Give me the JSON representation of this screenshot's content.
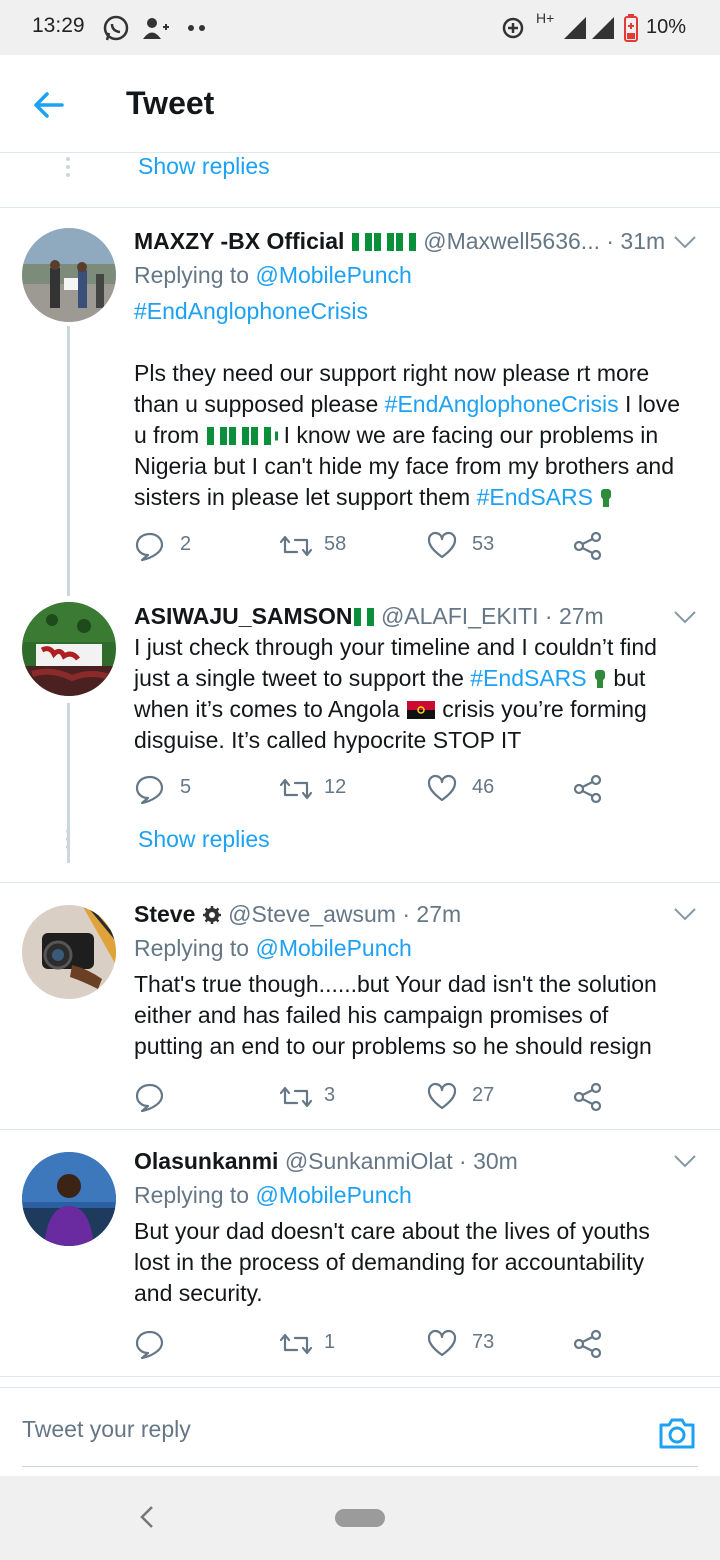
{
  "status_bar": {
    "time": "13:29",
    "battery": "10%",
    "network": "H+"
  },
  "app_bar": {
    "title": "Tweet"
  },
  "top_show_replies": "Show replies",
  "tweets": [
    {
      "name": "MAXZY -BX Official",
      "handle": "@Maxwell5636...",
      "time": "· 31m",
      "replying_prefix": "Replying to ",
      "replying_to": "@MobilePunch",
      "hashtag_line": "#EndAnglophoneCrisis",
      "body": {
        "l1": "Pls they need our support right now please rt more",
        "l2a": "than u supposed please ",
        "l2tag": "#EndAnglophoneCrisis",
        "l2b": " I love",
        "l3a": "u from ",
        "l3b": "I know we are facing our problems in",
        "l4": "Nigeria but I can't hide my face from my brothers and",
        "l5a": "sisters in please let support them ",
        "l5tag": "#EndSARS"
      },
      "replies": "2",
      "retweets": "58",
      "likes": "53"
    },
    {
      "name": "ASIWAJU_SAMSON",
      "handle": "@ALAFI_EKITI",
      "time": "· 27m",
      "body": {
        "l1": "I just check through your timeline and I couldn’t find",
        "l2a": "just a single tweet to support the ",
        "l2tag": "#EndSARS",
        "l2b": " but",
        "l3a": "when it’s comes to Angola ",
        "l3b": " crisis you’re forming",
        "l4": "disguise. It’s called hypocrite STOP IT"
      },
      "replies": "5",
      "retweets": "12",
      "likes": "46",
      "show_replies": "Show replies"
    },
    {
      "name": "Steve",
      "handle": "@Steve_awsum",
      "time": "· 27m",
      "replying_prefix": "Replying to ",
      "replying_to": "@MobilePunch",
      "body": {
        "l1": "That's true though......but Your dad isn't the solution",
        "l2": "either and has failed his campaign promises of",
        "l3": "putting an end to our problems so he should resign"
      },
      "replies": "",
      "retweets": "3",
      "likes": "27"
    },
    {
      "name": "Olasunkanmi",
      "handle": "@SunkanmiOlat",
      "time": "· 30m",
      "replying_prefix": "Replying to ",
      "replying_to": "@MobilePunch",
      "body": {
        "l1": "But your dad doesn't care about the lives of youths",
        "l2": "lost in the process of demanding for accountability",
        "l3": "and security."
      },
      "replies": "",
      "retweets": "1",
      "likes": "73"
    }
  ],
  "reply_bar": {
    "placeholder": "Tweet your reply"
  },
  "colors": {
    "link": "#1da1f2",
    "muted": "#657786",
    "text": "#14171a",
    "divider": "#e1e8ed"
  }
}
